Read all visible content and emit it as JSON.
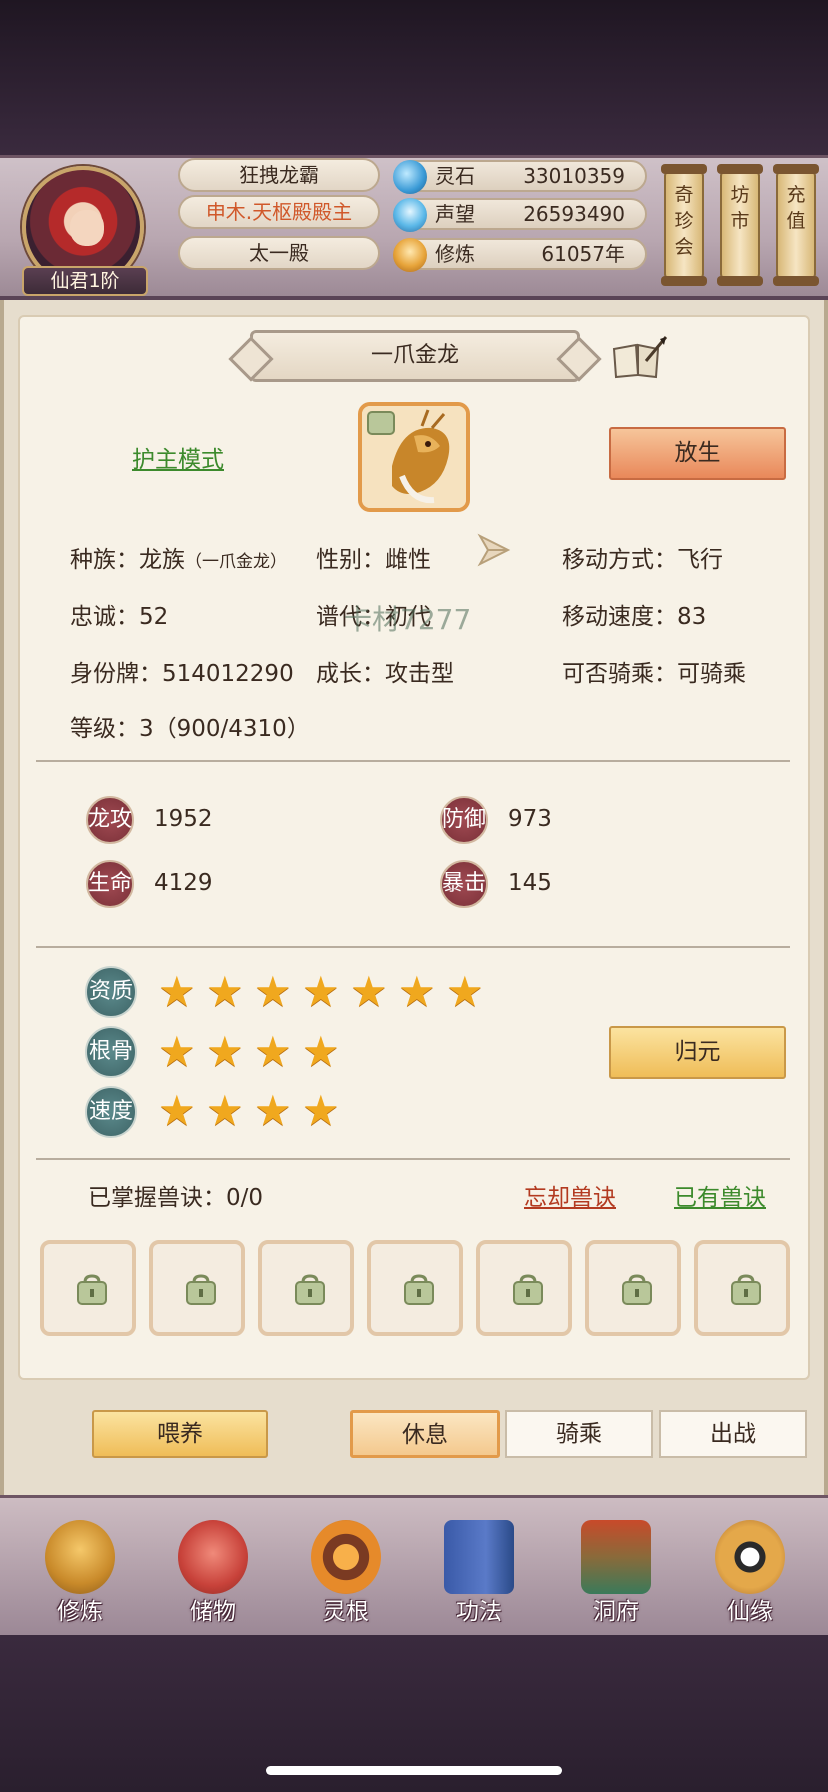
{
  "header": {
    "rank": "仙君1阶",
    "player_name": "狂拽龙霸",
    "title": "申木.天枢殿殿主",
    "hall": "太一殿",
    "resources": [
      {
        "label": "灵石",
        "value": "33010359",
        "icon": "spirit-stone-icon"
      },
      {
        "label": "声望",
        "value": "26593490",
        "icon": "reputation-crystal-icon"
      },
      {
        "label": "修炼",
        "value": "61057年",
        "icon": "cultivation-meditation-icon"
      }
    ],
    "scroll_buttons": [
      "奇珍会",
      "坊市",
      "充值"
    ]
  },
  "pet": {
    "name": "一爪金龙",
    "protect_mode": "护主模式",
    "release": "放生",
    "race_label": "种族：",
    "race": "龙族",
    "race_sub": "（一爪金龙）",
    "gender": "性别：雌性",
    "move_type": "移动方式：飞行",
    "loyalty": "忠诚：52",
    "generation": "谱代：初代",
    "move_speed": "移动速度：83",
    "id_tag": "身份牌：514012290",
    "growth": "成长：攻击型",
    "rideable": "可否骑乘：可骑乘",
    "level": "等级：3（900/4310）",
    "watermark": "卡材7277"
  },
  "stats": [
    {
      "label": "龙攻",
      "value": "1952"
    },
    {
      "label": "防御",
      "value": "973"
    },
    {
      "label": "生命",
      "value": "4129"
    },
    {
      "label": "暴击",
      "value": "145"
    }
  ],
  "aptitude": [
    {
      "label": "资质",
      "stars": 7
    },
    {
      "label": "根骨",
      "stars": 4
    },
    {
      "label": "速度",
      "stars": 4
    }
  ],
  "return_button": "归元",
  "skills": {
    "mastered": "已掌握兽诀：0/0",
    "forget": "忘却兽诀",
    "owned": "已有兽诀"
  },
  "actions": {
    "feed": "喂养",
    "rest": "休息",
    "ride": "骑乘",
    "fight": "出战"
  },
  "nav": [
    "修炼",
    "储物",
    "灵根",
    "功法",
    "洞府",
    "仙缘"
  ],
  "colors": {
    "accent_green": "#3c8a2c",
    "accent_red": "#b33a20",
    "accent_orange": "#d0582a",
    "gold": "#f0a81e"
  }
}
